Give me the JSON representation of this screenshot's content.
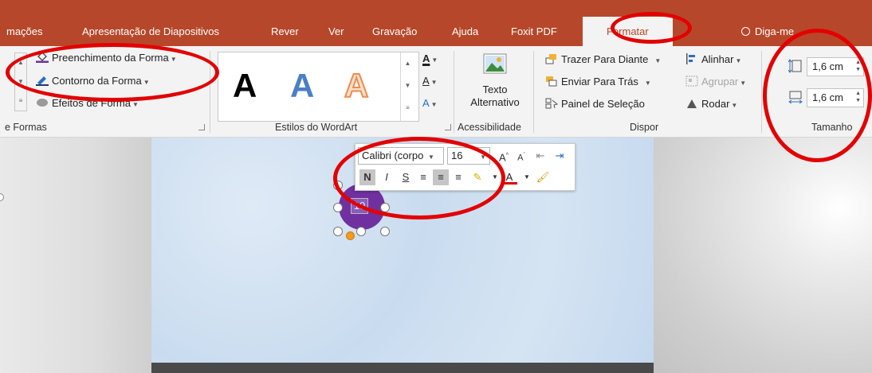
{
  "tabs": [
    {
      "label": "mações"
    },
    {
      "label": "Apresentação de Diapositivos"
    },
    {
      "label": "Rever"
    },
    {
      "label": "Ver"
    },
    {
      "label": "Gravação"
    },
    {
      "label": "Ajuda"
    },
    {
      "label": "Foxit PDF"
    },
    {
      "label": "Formatar"
    },
    {
      "label": "Diga-me"
    }
  ],
  "shape_styles": {
    "fill_label": "Preenchimento da Forma",
    "outline_label": "Contorno da Forma",
    "effects_label": "Efeitos de Forma",
    "group_label": "e Formas"
  },
  "wordart": {
    "letters": [
      "A",
      "A",
      "A"
    ],
    "group_label": "Estilos do WordArt",
    "text_fill": "A",
    "text_outline": "A",
    "text_effects": "A"
  },
  "accessibility": {
    "alt_text_line1": "Texto",
    "alt_text_line2": "Alternativo",
    "group_label": "Acessibilidade"
  },
  "arrange": {
    "bring_forward": "Trazer Para Diante",
    "send_backward": "Enviar Para Trás",
    "selection_pane": "Painel de Seleção",
    "align": "Alinhar",
    "group": "Agrupar",
    "rotate": "Rodar",
    "group_label": "Dispor"
  },
  "size": {
    "height": "1,6 cm",
    "width": "1,6 cm",
    "group_label": "Tamanho"
  },
  "mini_toolbar": {
    "font": "Calibri (corpo",
    "font_size": "16",
    "bold": "N",
    "italic": "I",
    "underline": "S"
  },
  "shape": {
    "text": "10"
  },
  "colors": {
    "ribbon_accent": "#b7472a",
    "shape_fill": "#7030a0",
    "annotation_red": "#e30000"
  }
}
